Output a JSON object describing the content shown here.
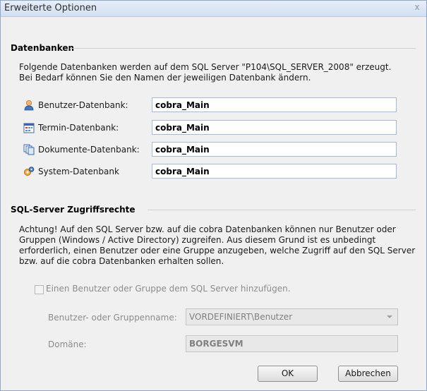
{
  "window": {
    "title": "Erweiterte Optionen",
    "close_glyph": "x"
  },
  "databases": {
    "heading": "Datenbanken",
    "description_line1": "Folgende Datenbanken werden auf dem SQL Server \"P104\\SQL_SERVER_2008\" erzeugt.",
    "description_line2": "Bei Bedarf können Sie den Namen der jeweiligen Datenbank ändern.",
    "rows": [
      {
        "label": "Benutzer-Datenbank:",
        "value": "cobra_Main",
        "icon": "user-icon"
      },
      {
        "label": "Termin-Datenbank:",
        "value": "cobra_Main",
        "icon": "calendar-icon"
      },
      {
        "label": "Dokumente-Datenbank:",
        "value": "cobra_Main",
        "icon": "documents-icon"
      },
      {
        "label": "System-Datenbank",
        "value": "cobra_Main",
        "icon": "gears-icon"
      }
    ]
  },
  "access": {
    "heading": "SQL-Server Zugriffsrechte",
    "description_line1": "Achtung! Auf den SQL Server bzw. auf die cobra Datenbanken können nur Benutzer oder",
    "description_line2": "Gruppen (Windows / Active Directory) zugreifen.  Aus diesem Grund ist es unbedingt",
    "description_line3": "erforderlich, einen Benutzer oder eine Gruppe anzugeben, welche Zugriff auf den SQL Server",
    "description_line4": "bzw. auf die cobra Datenbanken erhalten sollen.",
    "checkbox_label": "Einen Benutzer oder Gruppe dem SQL Server hinzufügen.",
    "checkbox_checked": false,
    "group_label": "Benutzer- oder Gruppenname:",
    "group_value": "VORDEFINIERT\\Benutzer",
    "domain_label": "Domäne:",
    "domain_value": "BORGESVM"
  },
  "buttons": {
    "ok": "OK",
    "cancel": "Abbrechen"
  },
  "colors": {
    "accent": "#1e5aa8",
    "window_border": "#8fa7c8",
    "background": "#f0f0f0"
  }
}
